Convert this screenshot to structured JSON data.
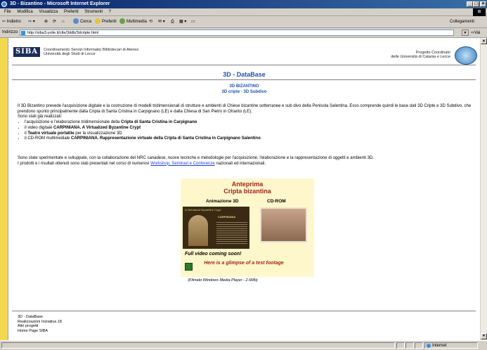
{
  "window": {
    "title": "3D - Bizantino - Microsoft Internet Explorer",
    "controls": [
      "_",
      "□",
      "×"
    ]
  },
  "menu": [
    "File",
    "Modifica",
    "Visualizza",
    "Preferiti",
    "Strumenti",
    "?"
  ],
  "toolbar": {
    "back": "Indietro",
    "search": "Cerca",
    "favorites": "Preferiti",
    "media": "Multimedia",
    "links": "Collegamenti"
  },
  "address": {
    "label": "Indirizzo",
    "url": "http://siba3.unile.it/ctle/3ddb/3dcripte.html",
    "go": "Vai"
  },
  "page": {
    "logo": "SIBA",
    "header_left_line1": "Coordinamento Servizi Informatici Bibliotecari di Ateneo",
    "header_left_line2": "Università degli Studi di Lecce",
    "header_right_line1": "Progetto Coordinato",
    "header_right_line2": "delle Università di Catania e Lecce",
    "title": "3D - DataBase",
    "subtitle1": "3D BIZANTINO",
    "subtitle2": "3D cripte - 3D Subdivo",
    "intro_p1": "Il 3D Bizantino prevede l'acquisizione digitale e la costruzione di modelli tridimensionali di strutture e ambienti di Chiese bizantine sotterranee e sub divo della Penisola Salentina. Esso comprende quindi le base dati 3D Cripte e 3D Subdivo, che prendono spunto principalmente dalla Cripta di Santa Cristina in Carpignano (LE) e dalla Chiesa di San Pietro in Otranto (LE).",
    "intro_p2": "Sono stati già realizzati:",
    "bullets": [
      {
        "pre": "l'acquisizione e l'elaborazione tridimensionale della ",
        "bold": "Cripta di Santa Cristina in Carpignano",
        "post": ""
      },
      {
        "pre": "il video digitale ",
        "bold": "CARPINIANA. A Virtualized Byzantine Crypt",
        "post": ""
      },
      {
        "pre": "il ",
        "bold": "Teatro virtuale portatile",
        "post": " per la visualizzazione 3D"
      },
      {
        "pre": "il CD-ROM multimediale ",
        "bold": "CARPINIANA. Rappresentazione virtuale della Cripta di Santa Cristina in Carpignano Salentino",
        "post": "."
      }
    ],
    "collab": "Sono state sperimentate e sviluppate, con la collaborazione del NRC canadese, nuove tecniche e metodologie per l'acquisizione, l'elaborazione e la rappresentazione di oggetti e ambienti 3D.",
    "results_pre": "I prodotti e i risultati ottenuti sono stati presentati nel corso di numerosi ",
    "results_link": "Workshop, Seminari e Conferenze",
    "results_post": " nazionali ed internazionali.",
    "preview_title_1": "Anteprima",
    "preview_title_2": "Cripta bizantina",
    "col_anim": "Animazione 3D",
    "col_cd": "CD-ROM",
    "film_header": "A Virtualized Byzantine Crypt",
    "film_title": "CARPINIANA",
    "full_video": "Full video coming soon!",
    "glimpse": "Here is a glimpse of a test footage",
    "filmato": "(Filmato Windows Media Player - 2.6Mb)",
    "footer": [
      "3D - DataBase",
      "Realizzazioni Iniziativa 18",
      "Altri progetti",
      "Home Page SIBA"
    ]
  },
  "status": {
    "zone": "Internet"
  }
}
